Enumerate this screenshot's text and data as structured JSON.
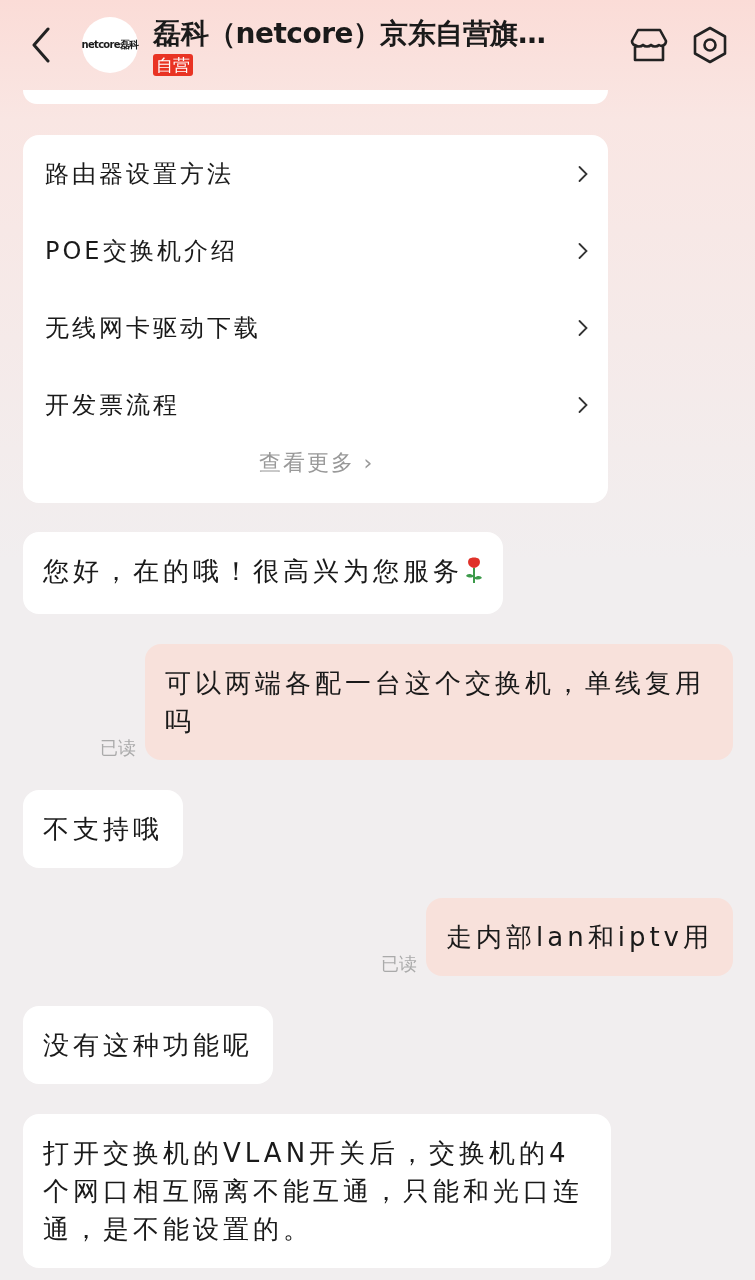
{
  "header": {
    "logo": "netcore磊科",
    "title": "磊科（netcore）京东自营旗…",
    "badge": "自营"
  },
  "menu": {
    "items": [
      "路由器设置方法",
      "POE交换机介绍",
      "无线网卡驱动下载",
      "开发票流程"
    ],
    "more": "查看更多 ›"
  },
  "messages": [
    {
      "kind": "incoming",
      "text": "您好，在的哦！很高兴为您服务",
      "has_icon": true
    },
    {
      "kind": "outgoing",
      "text": "可以两端各配一台这个交换机，单线复用吗",
      "read_label": "已读"
    },
    {
      "kind": "incoming",
      "text": "不支持哦"
    },
    {
      "kind": "outgoing",
      "text": "走内部lan和iptv用",
      "read_label": "已读"
    },
    {
      "kind": "incoming",
      "text": "没有这种功能呢"
    },
    {
      "kind": "incoming",
      "text": "打开交换机的VLAN开关后，交换机的4个网口相互隔离不能互通，只能和光口连通，是不能设置的。"
    }
  ]
}
